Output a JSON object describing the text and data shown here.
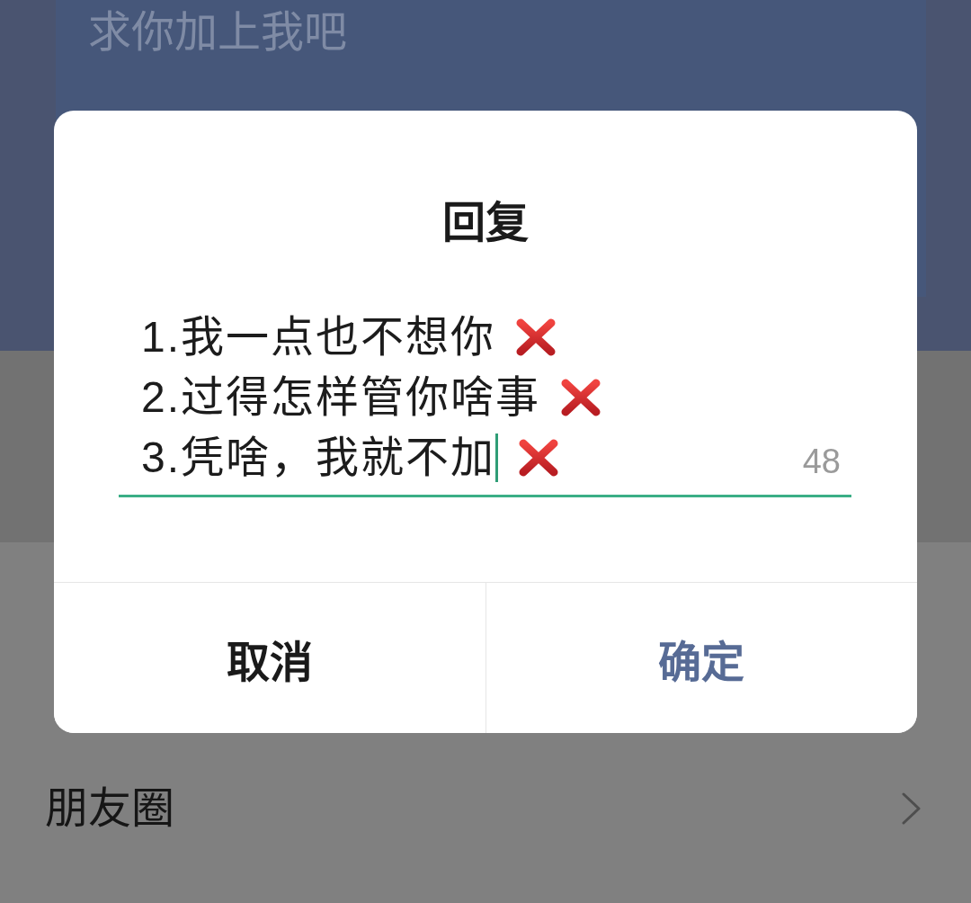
{
  "background": {
    "message_card": {
      "text": "求你加上我吧"
    },
    "list_items": [
      {
        "label": "朋友圈"
      }
    ]
  },
  "dialog": {
    "title": "回复",
    "field": {
      "focused": true,
      "lines": [
        "1.我一点也不想你",
        "2.过得怎样管你啥事",
        "3.凭啥，我就不加"
      ],
      "counter": "48"
    },
    "buttons": [
      {
        "label": "取消",
        "kind": "cancel"
      },
      {
        "label": "确定",
        "kind": "confirm"
      }
    ]
  }
}
